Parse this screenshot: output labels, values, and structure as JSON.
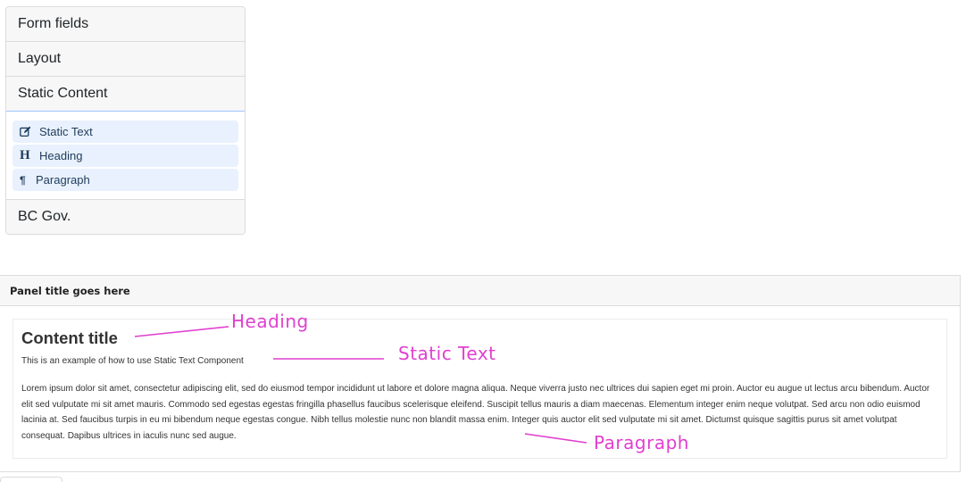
{
  "accordion": {
    "sections": [
      {
        "label": "Form fields"
      },
      {
        "label": "Layout"
      },
      {
        "label": "Static Content"
      },
      {
        "label": "BC Gov."
      }
    ],
    "static_content_items": [
      {
        "label": "Static Text",
        "icon": "edit-icon"
      },
      {
        "label": "Heading",
        "icon": "heading-icon"
      },
      {
        "label": "Paragraph",
        "icon": "paragraph-icon"
      }
    ]
  },
  "panel": {
    "title": "Panel title goes here",
    "content_title": "Content title",
    "static_text": "This is an example of how to use Static Text Component",
    "paragraph": "Lorem ipsum dolor sit amet, consectetur adipiscing elit, sed do eiusmod tempor incididunt ut labore et dolore magna aliqua. Neque viverra justo nec ultrices dui sapien eget mi proin. Auctor eu augue ut lectus arcu bibendum. Auctor elit sed vulputate mi sit amet mauris. Commodo sed egestas egestas fringilla phasellus faucibus scelerisque eleifend. Suscipit tellus mauris a diam maecenas. Elementum integer enim neque volutpat. Sed arcu non odio euismod lacinia at. Sed faucibus turpis in eu mi bibendum neque egestas congue. Nibh tellus molestie nunc non blandit massa enim. Integer quis auctor elit sed vulputate mi sit amet. Dictumst quisque sagittis purus sit amet volutpat consequat. Dapibus ultrices in iaculis nunc sed augue."
  },
  "annotations": {
    "heading": "Heading",
    "static_text": "Static Text",
    "paragraph": "Paragraph"
  },
  "colors": {
    "annotation": "#e040d0",
    "item_bg": "#e8f1fd"
  }
}
